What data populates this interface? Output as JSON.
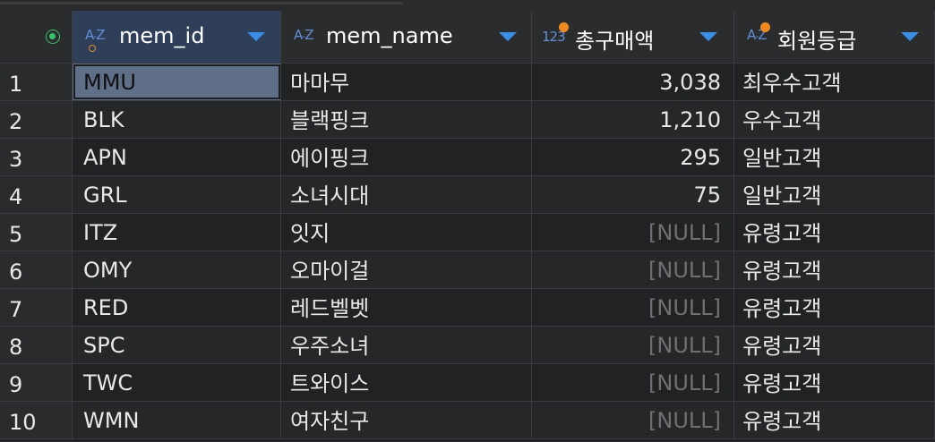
{
  "columns": [
    {
      "name": "mem_id",
      "type_icon": "A-Z",
      "key": true
    },
    {
      "name": "mem_name",
      "type_icon": "A-Z",
      "key": false
    },
    {
      "name": "총구매액",
      "type_icon": "123",
      "key": false
    },
    {
      "name": "회원등급",
      "type_icon": "A-Z",
      "key": false
    }
  ],
  "accent_colors": {
    "sort_caret": "#3b8ee8",
    "select_all": "#33c466",
    "computed_column_dot": "#f08a1e"
  },
  "rows": [
    {
      "row_number": "1",
      "mem_id": "MMU",
      "mem_name": "마마무",
      "total_purchase": "3,038",
      "grade": "최우수고객"
    },
    {
      "row_number": "2",
      "mem_id": "BLK",
      "mem_name": "블랙핑크",
      "total_purchase": "1,210",
      "grade": "우수고객"
    },
    {
      "row_number": "3",
      "mem_id": "APN",
      "mem_name": "에이핑크",
      "total_purchase": "295",
      "grade": "일반고객"
    },
    {
      "row_number": "4",
      "mem_id": "GRL",
      "mem_name": "소녀시대",
      "total_purchase": "75",
      "grade": "일반고객"
    },
    {
      "row_number": "5",
      "mem_id": "ITZ",
      "mem_name": "잇지",
      "total_purchase": "[NULL]",
      "grade": "유령고객"
    },
    {
      "row_number": "6",
      "mem_id": "OMY",
      "mem_name": "오마이걸",
      "total_purchase": "[NULL]",
      "grade": "유령고객"
    },
    {
      "row_number": "7",
      "mem_id": "RED",
      "mem_name": "레드벨벳",
      "total_purchase": "[NULL]",
      "grade": "유령고객"
    },
    {
      "row_number": "8",
      "mem_id": "SPC",
      "mem_name": "우주소녀",
      "total_purchase": "[NULL]",
      "grade": "유령고객"
    },
    {
      "row_number": "9",
      "mem_id": "TWC",
      "mem_name": "트와이스",
      "total_purchase": "[NULL]",
      "grade": "유령고객"
    },
    {
      "row_number": "10",
      "mem_id": "WMN",
      "mem_name": "여자친구",
      "total_purchase": "[NULL]",
      "grade": "유령고객"
    }
  ]
}
